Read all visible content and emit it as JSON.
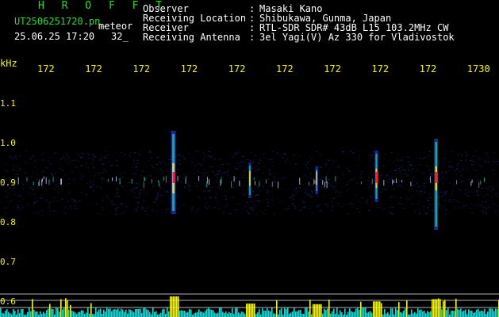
{
  "header": {
    "brand": "H R O F F T",
    "file": "UT2506251720.pn_",
    "mode": "meteor",
    "datetime": "25.06.25 17:20",
    "count": "32_"
  },
  "info": [
    {
      "label": "Observer",
      "value": "Masaki Kano"
    },
    {
      "label": "Receiving Location",
      "value": "Shibukawa, Gunma, Japan"
    },
    {
      "label": "Receiver",
      "value": "RTL-SDR SDR# 43dB L15 103.2MHz CW"
    },
    {
      "label": "Receiving Antenna",
      "value": "3el Yagi(V) Az 330 for Vladivostok"
    }
  ],
  "info_colon": ":",
  "chart_data": {
    "type": "heatmap",
    "ylabel": "kHz",
    "x_tick_labels": [
      "172",
      "172",
      "172",
      "172",
      "172",
      "172",
      "172",
      "172",
      "172",
      "1730"
    ],
    "y_ticks": [
      1.1,
      1.0,
      0.9,
      0.8,
      0.7,
      0.6
    ],
    "y_range": [
      0.6,
      1.15
    ],
    "noise_band_khz": [
      0.82,
      0.98
    ],
    "carrier_khz": 0.91,
    "meteor_echoes": [
      {
        "x_index": 3.0,
        "strength": 1.0,
        "span_khz": [
          0.82,
          1.03
        ]
      },
      {
        "x_index": 4.6,
        "strength": 0.35,
        "span_khz": [
          0.86,
          0.95
        ]
      },
      {
        "x_index": 6.0,
        "strength": 0.3,
        "span_khz": [
          0.87,
          0.94
        ]
      },
      {
        "x_index": 7.25,
        "strength": 0.55,
        "span_khz": [
          0.85,
          0.98
        ]
      },
      {
        "x_index": 8.5,
        "strength": 0.75,
        "span_khz": [
          0.78,
          1.01
        ]
      }
    ],
    "colors": {
      "background": "#000000",
      "noise": "#1a2fa0",
      "signal_mid": "#10c0a0",
      "signal_high": "#f0e020",
      "signal_peak": "#ff2020",
      "histogram": "#20d0d0",
      "histogram_peak": "#f4f400",
      "guide_lines": "#b0b0b0",
      "label_yellow": "#f4f400",
      "brand_green": "#22e022"
    }
  }
}
